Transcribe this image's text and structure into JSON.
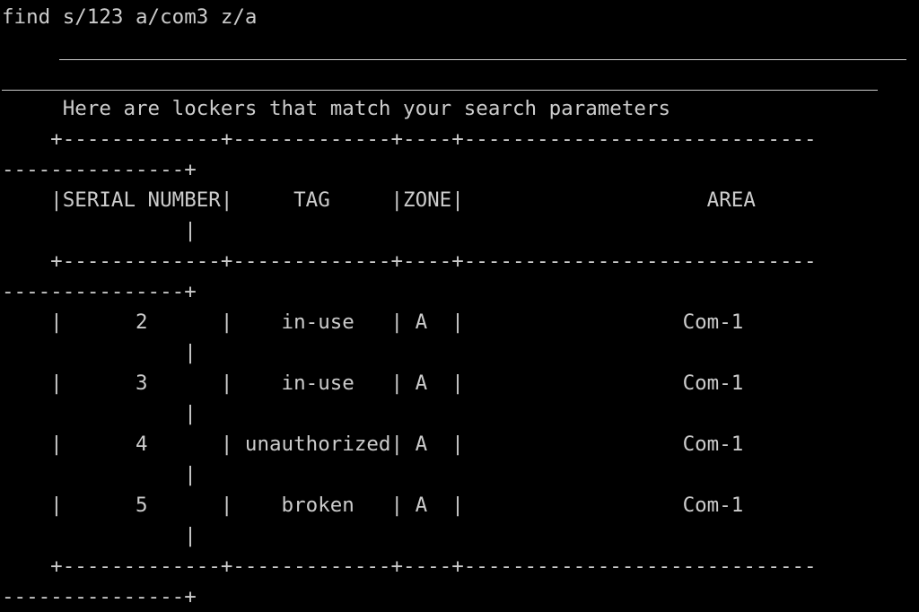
{
  "terminal": {
    "background": "#000000",
    "foreground": "#cccccc",
    "lines": [
      "find s/123 a/com3 z/a",
      "",
      "",
      "     Here are lockers that match your search parameters",
      "    +-------------+-------------+----+-----------------------------",
      "---------------+",
      "    |SERIAL NUMBER|     TAG     |ZONE|                    AREA",
      "               |",
      "    +-------------+-------------+----+-----------------------------",
      "---------------+",
      "    |      2      |    in-use   | A  |                  Com-1",
      "               |",
      "    |      3      |    in-use   | A  |                  Com-1",
      "               |",
      "    |      4      | unauthorized| A  |                  Com-1",
      "               |",
      "    |      5      |    broken   | A  |                  Com-1",
      "               |",
      "    +-------------+-------------+----+-----------------------------",
      "---------------+"
    ]
  }
}
